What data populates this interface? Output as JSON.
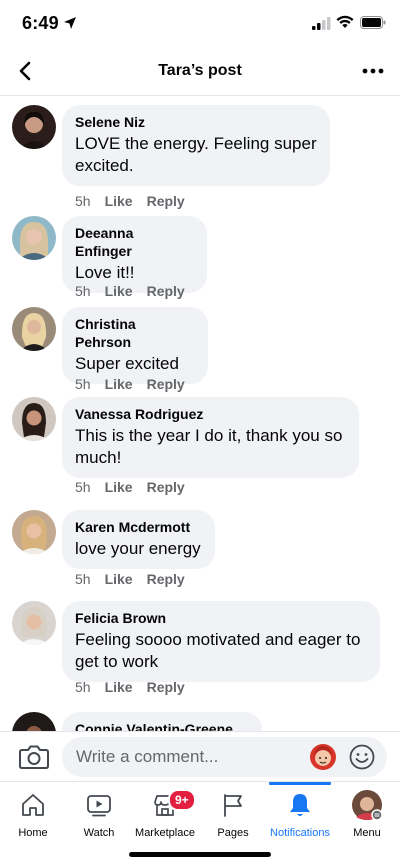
{
  "status_bar": {
    "time": "6:49"
  },
  "header": {
    "title": "Tara’s post"
  },
  "comments": [
    {
      "author": "Selene Niz",
      "text": "LOVE the energy. Feeling super excited.",
      "time": "5h",
      "like": "Like",
      "reply": "Reply"
    },
    {
      "author": "Deeanna Enfinger",
      "text": "Love it!!",
      "time": "5h",
      "like": "Like",
      "reply": "Reply"
    },
    {
      "author": "Christina Pehrson",
      "text": "Super excited",
      "time": "5h",
      "like": "Like",
      "reply": "Reply"
    },
    {
      "author": "Vanessa Rodriguez",
      "text": "This is the year I do it, thank you so much!",
      "time": "5h",
      "like": "Like",
      "reply": "Reply"
    },
    {
      "author": "Karen Mcdermott",
      "text": "love your energy",
      "time": "5h",
      "like": "Like",
      "reply": "Reply"
    },
    {
      "author": "Felicia Brown",
      "text": "Feeling soooo motivated and eager to get to work",
      "time": "5h",
      "like": "Like",
      "reply": "Reply"
    },
    {
      "author": "Connie Valentin-Greene"
    }
  ],
  "composer": {
    "placeholder": "Write a comment..."
  },
  "tabs": [
    {
      "label": "Home",
      "icon": "home-icon"
    },
    {
      "label": "Watch",
      "icon": "watch-icon"
    },
    {
      "label": "Marketplace",
      "icon": "marketplace-icon",
      "badge": "9+"
    },
    {
      "label": "Pages",
      "icon": "flag-icon"
    },
    {
      "label": "Notifications",
      "icon": "bell-icon",
      "active": true
    },
    {
      "label": "Menu",
      "icon": "avatar"
    }
  ],
  "colors": {
    "accent": "#1877f2",
    "bubble": "#f0f2f5",
    "badge": "#e41e3f",
    "muted": "#65676b"
  }
}
